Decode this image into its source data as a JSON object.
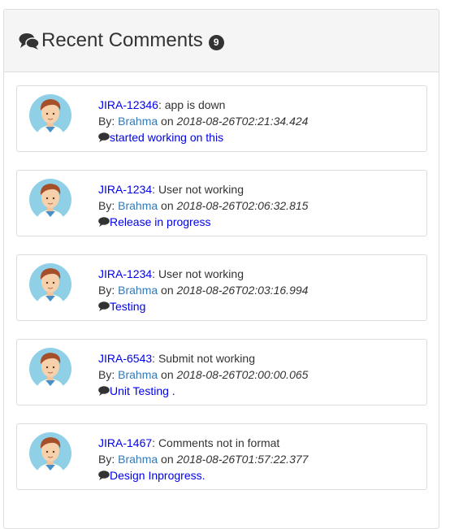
{
  "header": {
    "title": "Recent Comments",
    "count": "9"
  },
  "comments": [
    {
      "issue": "JIRA-12346",
      "separator": ": ",
      "summary": "app is down",
      "by_label": "By: ",
      "author": "Brahma",
      "on_label": " on ",
      "timestamp": "2018-08-26T02:21:34.424",
      "text": "started working on this"
    },
    {
      "issue": "JIRA-1234",
      "separator": ": ",
      "summary": "User not working",
      "by_label": "By: ",
      "author": "Brahma",
      "on_label": " on ",
      "timestamp": "2018-08-26T02:06:32.815",
      "text": "Release in progress"
    },
    {
      "issue": "JIRA-1234",
      "separator": ": ",
      "summary": "User not working",
      "by_label": "By: ",
      "author": "Brahma",
      "on_label": " on ",
      "timestamp": "2018-08-26T02:03:16.994",
      "text": "Testing"
    },
    {
      "issue": "JIRA-6543",
      "separator": ": ",
      "summary": "Submit not working",
      "by_label": "By: ",
      "author": "Brahma",
      "on_label": " on ",
      "timestamp": "2018-08-26T02:00:00.065",
      "text": "Unit Testing ."
    },
    {
      "issue": "JIRA-1467",
      "separator": ": ",
      "summary": "Comments not in format",
      "by_label": "By: ",
      "author": "Brahma",
      "on_label": " on ",
      "timestamp": "2018-08-26T01:57:22.377",
      "text": "Design Inprogress."
    }
  ],
  "icons": {
    "heading": "comments-icon",
    "comment": "comment-bubble-icon",
    "avatar": "user-avatar"
  },
  "colors": {
    "link": "#0000ee",
    "author": "#337ab7",
    "badge": "#333333",
    "heading_bg": "#f5f5f5",
    "avatar_bg": "#8fd0e6"
  }
}
